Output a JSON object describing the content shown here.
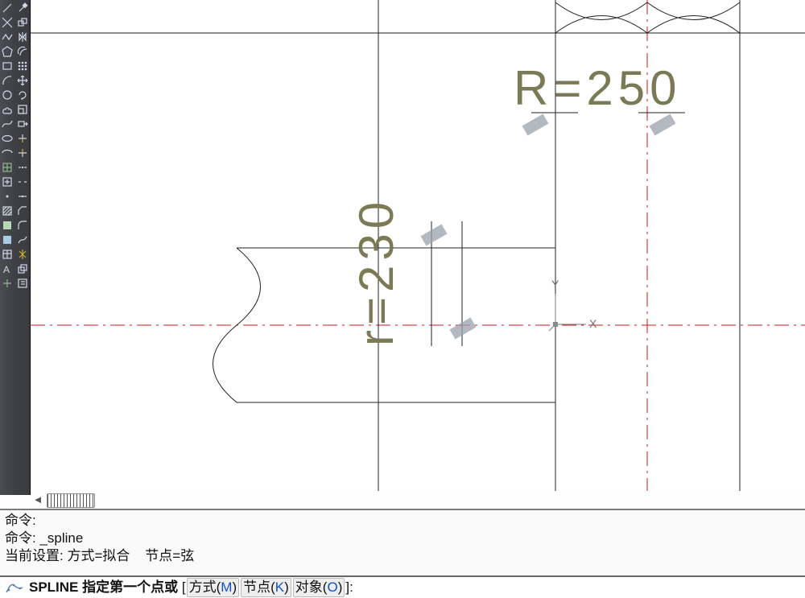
{
  "annotations": {
    "R_label": "R=250",
    "r_label": "r=230"
  },
  "ucs": {
    "x": "X",
    "y": "Y"
  },
  "command_history": {
    "line1": "命令:",
    "line2_prefix": "命令: ",
    "line2_cmd": "_spline",
    "line3": "当前设置: 方式=拟合    节点=弦"
  },
  "cli": {
    "base": "SPLINE 指定第一个点或 ",
    "open": "[",
    "opt1": "方式(",
    "key1": "M",
    "opt2": ") 节点(",
    "key2": "K",
    "opt3": ") 对象(",
    "key3": "O",
    "close": ")]:"
  }
}
